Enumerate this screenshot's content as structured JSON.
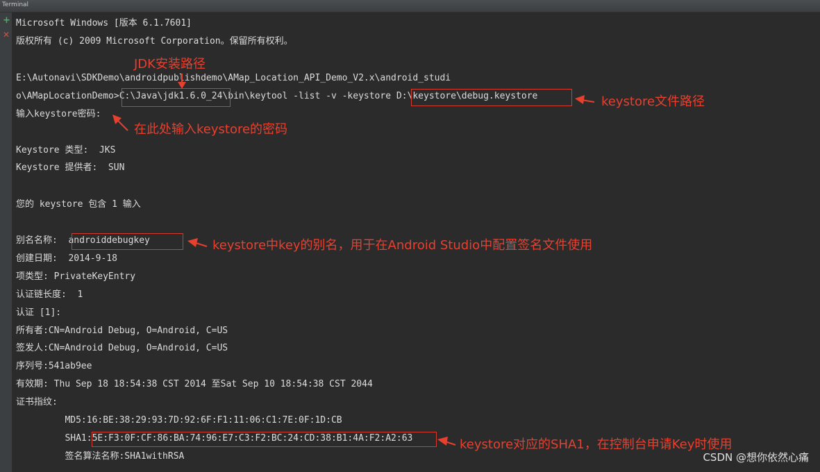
{
  "window": {
    "title": "Terminal"
  },
  "gutter": {
    "add_icon": "plus-icon",
    "close_icon": "close-icon",
    "add_color": "#59a869",
    "close_color": "#c75450"
  },
  "terminal": {
    "lines": [
      "Microsoft Windows [版本 6.1.7601]",
      "版权所有 (c) 2009 Microsoft Corporation。保留所有权利。",
      "E:\\Autonavi\\SDKDemo\\androidpublishdemo\\AMap_Location_API_Demo_V2.x\\android_studi",
      "o\\AMapLocationDemo>C:\\Java\\jdk1.6.0_24\\bin\\keytool -list -v -keystore D:\\keystore\\debug.keystore",
      "输入keystore密码:",
      "Keystore 类型:  JKS",
      "Keystore 提供者:  SUN",
      "您的 keystore 包含 1 输入",
      "别名名称:  androiddebugkey",
      "创建日期:  2014-9-18",
      "项类型: PrivateKeyEntry",
      "认证链长度:  1",
      "认证 [1]:",
      "所有者:CN=Android Debug, O=Android, C=US",
      "签发人:CN=Android Debug, O=Android, C=US",
      "序列号:541ab9ee",
      "有效期: Thu Sep 18 18:54:38 CST 2014 至Sat Sep 10 18:54:38 CST 2044",
      "证书指纹:",
      "         MD5:16:BE:38:29:93:7D:92:6F:F1:11:06:C1:7E:0F:1D:CB",
      "         SHA1:5E:F3:0F:CF:86:BA:74:96:E7:C3:F2:BC:24:CD:38:B1:4A:F2:A2:63",
      "         签名算法名称:SHA1withRSA"
    ]
  },
  "annotations": {
    "jdk_path": "JDK安装路径",
    "keystore_path": "keystore文件路径",
    "password": "在此处输入keystore的密码",
    "alias": "keystore中key的别名，用于在Android Studio中配置签名文件使用",
    "sha1": "keystore对应的SHA1，在控制台申请Key时使用",
    "color": "#e8402f"
  },
  "watermark": "CSDN @想你依然心痛"
}
